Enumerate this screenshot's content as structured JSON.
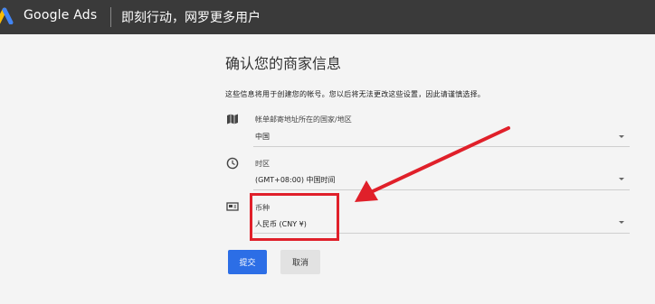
{
  "header": {
    "brand": "Google Ads",
    "slogan": "即刻行动，网罗更多用户"
  },
  "form": {
    "title": "确认您的商家信息",
    "description": "这些信息将用于创建您的帐号。您以后将无法更改这些设置，因此请谨慎选择。",
    "fields": [
      {
        "label": "帐单邮寄地址所在的国家/地区",
        "value": "中国",
        "icon": "map-icon"
      },
      {
        "label": "时区",
        "value": "(GMT+08:00) 中国时间",
        "icon": "clock-icon"
      },
      {
        "label": "币种",
        "value": "人民币 (CNY ¥)",
        "icon": "currency-icon"
      }
    ],
    "submit_label": "提交",
    "cancel_label": "取消"
  },
  "colors": {
    "header_bg": "#3a3a3a",
    "primary": "#2c6ee6",
    "highlight": "#e0202a"
  }
}
